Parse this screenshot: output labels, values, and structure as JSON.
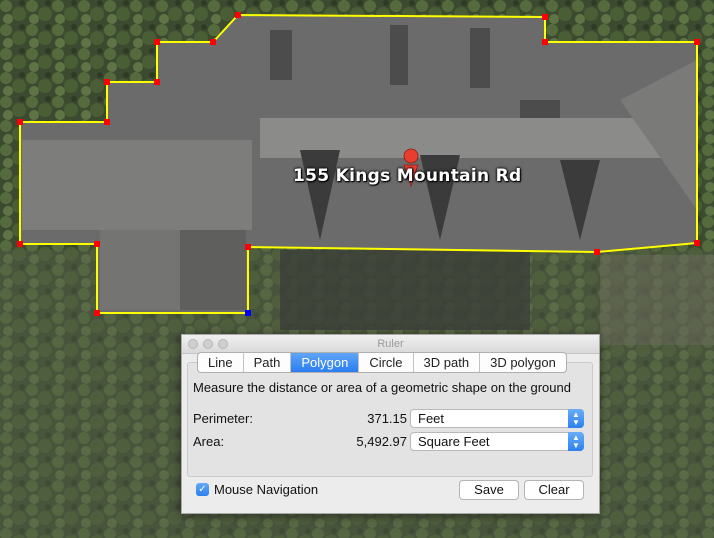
{
  "map": {
    "address_label": "155 Kings Mountain Rd",
    "polygon_color": "#ffff00",
    "vertex_color": "#ff0000",
    "active_vertex_color": "#0000ff"
  },
  "ruler": {
    "title": "Ruler",
    "tabs": [
      {
        "label": "Line",
        "active": false
      },
      {
        "label": "Path",
        "active": false
      },
      {
        "label": "Polygon",
        "active": true
      },
      {
        "label": "Circle",
        "active": false
      },
      {
        "label": "3D path",
        "active": false
      },
      {
        "label": "3D polygon",
        "active": false
      }
    ],
    "description": "Measure the distance or area of a geometric shape on the ground",
    "perimeter": {
      "label": "Perimeter:",
      "value": "371.15",
      "unit": "Feet"
    },
    "area": {
      "label": "Area:",
      "value": "5,492.97",
      "unit": "Square Feet"
    },
    "mouse_navigation": {
      "label": "Mouse Navigation",
      "checked": true
    },
    "save_label": "Save",
    "clear_label": "Clear",
    "accent_color": "#2a7ef0"
  }
}
